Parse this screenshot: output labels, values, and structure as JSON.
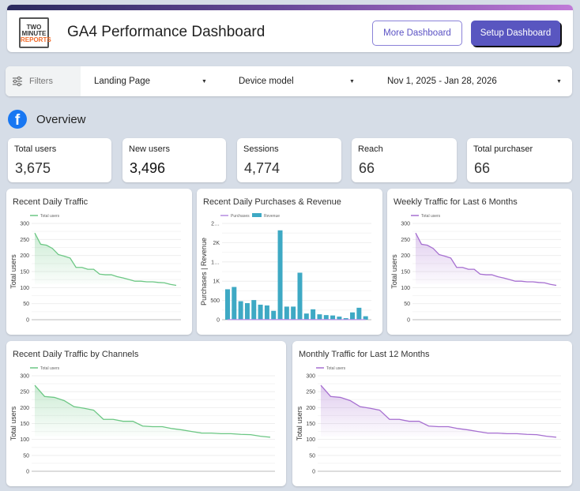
{
  "header": {
    "logo": [
      "TWO",
      "MINUTE",
      "REPORTS"
    ],
    "title": "GA4 Performance Dashboard",
    "more_button": "More Dashboard",
    "setup_button": "Setup Dashboard"
  },
  "filters": {
    "label": "Filters",
    "landing_page": "Landing Page",
    "device_model": "Device model",
    "date_range": "Nov 1, 2025 - Jan 28, 2026"
  },
  "overview": {
    "title": "Overview",
    "icon": "facebook-icon"
  },
  "kpis": [
    {
      "label": "Total users",
      "value": "3,675"
    },
    {
      "label": "New users",
      "value": "3,496"
    },
    {
      "label": "Sessions",
      "value": "4,774"
    },
    {
      "label": "Reach",
      "value": "66"
    },
    {
      "label": "Total purchaser",
      "value": "66"
    }
  ],
  "chart_data": [
    {
      "type": "area",
      "title": "Recent Daily Traffic",
      "ylabel": "Total users",
      "legend": [
        "Total users"
      ],
      "color": "#6cc784",
      "ylim": [
        0,
        300
      ],
      "yticks": [
        "0",
        "50",
        "100",
        "150",
        "200",
        "250",
        "300"
      ],
      "series": [
        {
          "name": "Total users",
          "values": [
            270,
            235,
            232,
            222,
            203,
            198,
            192,
            163,
            163,
            157,
            157,
            142,
            140,
            140,
            134,
            130,
            125,
            120,
            120,
            118,
            118,
            116,
            115,
            110,
            107
          ]
        }
      ]
    },
    {
      "type": "bar",
      "title": "Recent Daily Purchases & Revenue",
      "ylabel": "Purchases | Revenue",
      "legend": [
        "Purchases",
        "Revenue"
      ],
      "color": "#3ea9c4",
      "line_color": "#b48be0",
      "ylim": [
        0,
        2500
      ],
      "yticks": [
        "0",
        "500",
        "1K",
        "1…",
        "2K",
        "2…"
      ],
      "series": [
        {
          "name": "Purchases",
          "values": [
            3,
            4,
            3,
            3,
            3,
            3,
            3,
            2,
            5,
            3,
            3,
            4,
            2,
            2,
            2,
            2,
            2,
            1,
            1,
            2,
            2,
            1
          ]
        },
        {
          "name": "Revenue",
          "values": [
            790,
            850,
            480,
            430,
            510,
            390,
            370,
            230,
            2320,
            340,
            340,
            1220,
            160,
            270,
            140,
            120,
            110,
            80,
            40,
            190,
            310,
            90
          ]
        }
      ]
    },
    {
      "type": "area",
      "title": "Weekly Traffic for Last 6 Months",
      "ylabel": "Total users",
      "legend": [
        "Total users"
      ],
      "color": "#a66fd0",
      "ylim": [
        0,
        300
      ],
      "yticks": [
        "0",
        "50",
        "100",
        "150",
        "200",
        "250",
        "300"
      ],
      "series": [
        {
          "name": "Total users",
          "values": [
            270,
            235,
            232,
            222,
            203,
            198,
            192,
            163,
            163,
            157,
            157,
            142,
            140,
            140,
            134,
            130,
            125,
            120,
            120,
            118,
            118,
            116,
            115,
            110,
            107
          ]
        }
      ]
    },
    {
      "type": "area",
      "title": "Recent Daily Traffic by Channels",
      "ylabel": "Total users",
      "legend": [
        "Total users"
      ],
      "color": "#6cc784",
      "ylim": [
        0,
        300
      ],
      "yticks": [
        "0",
        "50",
        "100",
        "150",
        "200",
        "250",
        "300"
      ],
      "series": [
        {
          "name": "Total users",
          "values": [
            270,
            235,
            232,
            222,
            203,
            198,
            192,
            163,
            163,
            157,
            157,
            142,
            140,
            140,
            134,
            130,
            125,
            120,
            120,
            118,
            118,
            116,
            115,
            110,
            107
          ]
        }
      ]
    },
    {
      "type": "area",
      "title": "Monthly Traffic for Last 12 Months",
      "ylabel": "Total users",
      "legend": [
        "Total users"
      ],
      "color": "#a66fd0",
      "ylim": [
        0,
        300
      ],
      "yticks": [
        "0",
        "50",
        "100",
        "150",
        "200",
        "250",
        "300"
      ],
      "series": [
        {
          "name": "Total users",
          "values": [
            270,
            235,
            232,
            222,
            203,
            198,
            192,
            163,
            163,
            157,
            157,
            142,
            140,
            140,
            134,
            130,
            125,
            120,
            120,
            118,
            118,
            116,
            115,
            110,
            107
          ]
        }
      ]
    }
  ]
}
